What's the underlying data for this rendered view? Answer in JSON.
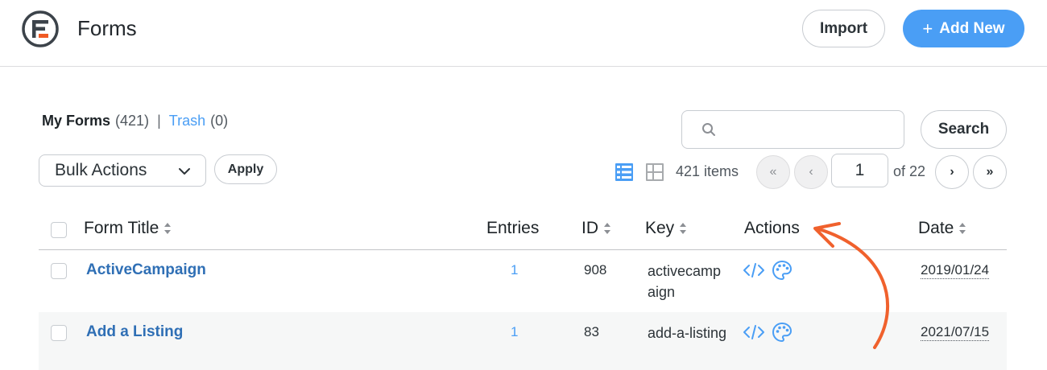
{
  "header": {
    "title": "Forms",
    "import_label": "Import",
    "add_new_plus": "+",
    "add_new_label": "Add New"
  },
  "views": {
    "my_forms_label": "My Forms",
    "my_forms_count": "(421)",
    "separator": "|",
    "trash_label": "Trash",
    "trash_count": "(0)"
  },
  "search": {
    "placeholder": "",
    "button_label": "Search"
  },
  "bulk_actions": {
    "selected": "Bulk Actions",
    "apply_label": "Apply"
  },
  "pagination": {
    "items_count": "421 items",
    "first": "«",
    "prev": "‹",
    "current_page": "1",
    "of_label": "of 22",
    "next": "›",
    "last": "»"
  },
  "table": {
    "columns": [
      "Form Title",
      "Entries",
      "ID",
      "Key",
      "Actions",
      "Date"
    ],
    "rows": [
      {
        "title": "ActiveCampaign",
        "entries": "1",
        "id": "908",
        "key": "activecampaign",
        "date": "2019/01/24"
      },
      {
        "title": "Add a Listing",
        "entries": "1",
        "id": "83",
        "key": "add-a-listing",
        "date": "2021/07/15"
      }
    ]
  },
  "colors": {
    "accent": "#4a9ef5",
    "link": "#2f6fb5",
    "annotation_arrow": "#f0612d",
    "logo_orange": "#f05a24"
  }
}
